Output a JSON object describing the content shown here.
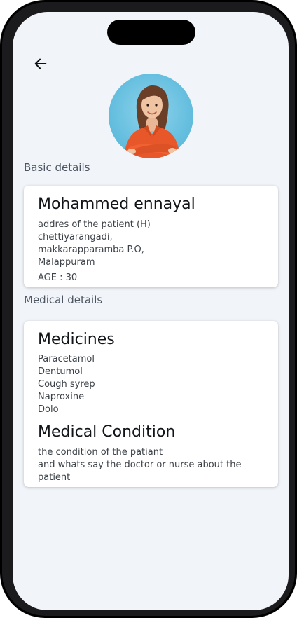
{
  "header": {
    "back_icon": "arrow-left-icon"
  },
  "profile": {
    "avatar_alt": "patient-photo"
  },
  "basic": {
    "section_label": "Basic details",
    "name": "Mohammed ennayal",
    "address_lines": [
      "addres of the patient (H)",
      "chettiyarangadi,",
      "makkarapparamba P.O,",
      "Malappuram"
    ],
    "age": "AGE : 30"
  },
  "medical": {
    "section_label": "Medical details",
    "medicines_title": "Medicines",
    "medicines": [
      "Paracetamol",
      "Dentumol",
      "Cough syrep",
      "Naproxine",
      "Dolo"
    ],
    "condition_title": "Medical Condition",
    "condition_lines": [
      "the condition of the patiant",
      "and whats say the doctor or nurse about the",
      "patient"
    ]
  }
}
